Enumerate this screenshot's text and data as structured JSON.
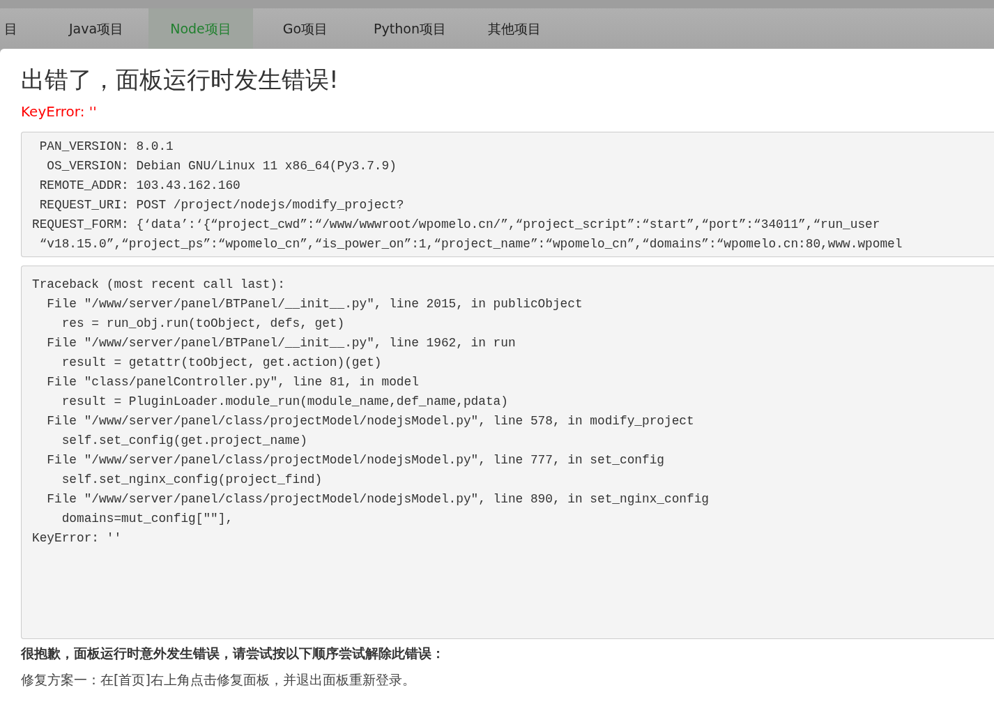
{
  "tabs": [
    {
      "label": "目",
      "selected": false
    },
    {
      "label": "Java项目",
      "selected": false
    },
    {
      "label": "Node项目",
      "selected": true
    },
    {
      "label": "Go项目",
      "selected": false
    },
    {
      "label": "Python项目",
      "selected": false
    },
    {
      "label": "其他项目",
      "selected": false
    }
  ],
  "error": {
    "title": "出错了，面板运行时发生错误!",
    "message": "KeyError: ''"
  },
  "request_info": {
    "lines": [
      " PAN_VERSION: 8.0.1",
      "  OS_VERSION: Debian GNU/Linux 11 x86_64(Py3.7.9)",
      " REMOTE_ADDR: 103.43.162.160",
      " REQUEST_URI: POST /project/nodejs/modify_project?",
      "REQUEST_FORM: {‘data’:‘{“project_cwd”:“/www/wwwroot/wpomelo.cn/”,“project_script”:“start”,“port”:“34011”,“run_user",
      " “v18.15.0”,“project_ps”:“wpomelo_cn”,“is_power_on”:1,“project_name”:“wpomelo_cn”,“domains”:“wpomelo.cn:80,www.wpomel"
    ]
  },
  "traceback": {
    "lines": [
      "Traceback (most recent call last):",
      "  File \"/www/server/panel/BTPanel/__init__.py\", line 2015, in publicObject",
      "    res = run_obj.run(toObject, defs, get)",
      "  File \"/www/server/panel/BTPanel/__init__.py\", line 1962, in run",
      "    result = getattr(toObject, get.action)(get)",
      "  File \"class/panelController.py\", line 81, in model",
      "    result = PluginLoader.module_run(module_name,def_name,pdata)",
      "  File \"/www/server/panel/class/projectModel/nodejsModel.py\", line 578, in modify_project",
      "    self.set_config(get.project_name)",
      "  File \"/www/server/panel/class/projectModel/nodejsModel.py\", line 777, in set_config",
      "    self.set_nginx_config(project_find)",
      "  File \"/www/server/panel/class/projectModel/nodejsModel.py\", line 890, in set_nginx_config",
      "    domains=mut_config[\"\"],",
      "KeyError: ''"
    ]
  },
  "help": {
    "heading": "很抱歉，面板运行时意外发生错误，请尝试按以下顺序尝试解除此错误：",
    "steps": [
      "修复方案一：在[首页]右上角点击修复面板，并退出面板重新登录。"
    ]
  }
}
